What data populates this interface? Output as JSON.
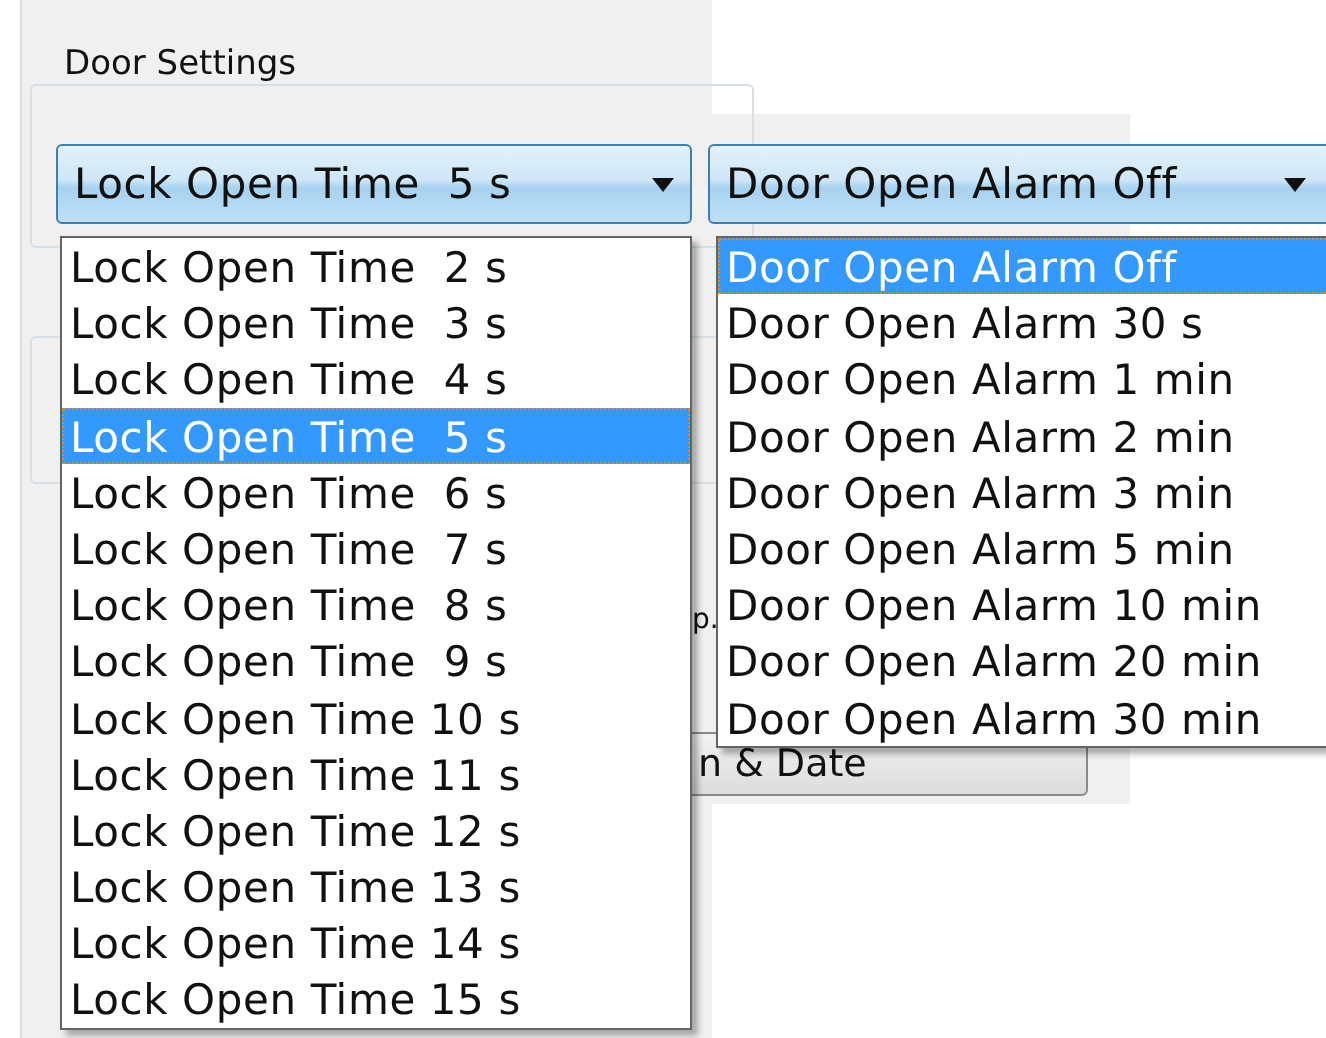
{
  "group": {
    "title": "Door Settings"
  },
  "lock_dropdown": {
    "value": "Lock Open Time  5 s",
    "expanded": true,
    "options": [
      {
        "label": "Lock Open Time  2 s",
        "selected": false
      },
      {
        "label": "Lock Open Time  3 s",
        "selected": false
      },
      {
        "label": "Lock Open Time  4 s",
        "selected": false
      },
      {
        "label": "Lock Open Time  5 s",
        "selected": true
      },
      {
        "label": "Lock Open Time  6 s",
        "selected": false
      },
      {
        "label": "Lock Open Time  7 s",
        "selected": false
      },
      {
        "label": "Lock Open Time  8 s",
        "selected": false
      },
      {
        "label": "Lock Open Time  9 s",
        "selected": false
      },
      {
        "label": "Lock Open Time 10 s",
        "selected": false
      },
      {
        "label": "Lock Open Time 11 s",
        "selected": false
      },
      {
        "label": "Lock Open Time 12 s",
        "selected": false
      },
      {
        "label": "Lock Open Time 13 s",
        "selected": false
      },
      {
        "label": "Lock Open Time 14 s",
        "selected": false
      },
      {
        "label": "Lock Open Time 15 s",
        "selected": false
      }
    ]
  },
  "alarm_dropdown": {
    "value": "Door Open Alarm Off",
    "expanded": true,
    "options": [
      {
        "label": "Door Open Alarm Off",
        "selected": true
      },
      {
        "label": "Door Open Alarm 30 s",
        "selected": false
      },
      {
        "label": "Door Open Alarm 1 min",
        "selected": false
      },
      {
        "label": "Door Open Alarm 2 min",
        "selected": false
      },
      {
        "label": "Door Open Alarm 3 min",
        "selected": false
      },
      {
        "label": "Door Open Alarm 5 min",
        "selected": false
      },
      {
        "label": "Door Open Alarm 10 min",
        "selected": false
      },
      {
        "label": "Door Open Alarm 20 min",
        "selected": false
      },
      {
        "label": "Door Open Alarm 30 min",
        "selected": false
      }
    ]
  },
  "hidden_text": "p.",
  "hidden_button": {
    "label": "n & Date"
  }
}
